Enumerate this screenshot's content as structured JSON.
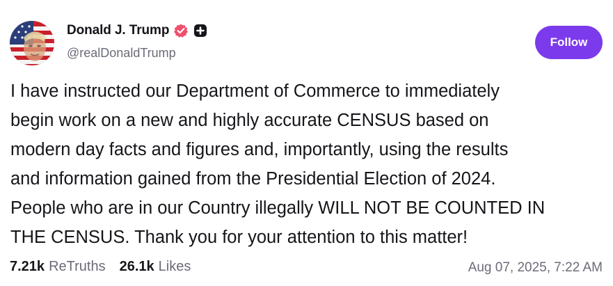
{
  "author": {
    "display_name": "Donald J. Trump",
    "handle": "@realDonaldTrump",
    "avatar_icon": "avatar-flag-portrait",
    "badges": [
      "verified-icon",
      "plus-icon"
    ]
  },
  "follow_label": "Follow",
  "post": {
    "lines": [
      "I have instructed our Department of Commerce to immediately",
      "begin work on a new and highly accurate CENSUS based on",
      "modern day facts and figures and, importantly, using the results",
      "and information gained from the Presidential Election of 2024.",
      "People who are in our Country illegally WILL NOT BE COUNTED IN",
      "THE CENSUS. Thank you for your attention to this matter!"
    ]
  },
  "stats": {
    "retruths_count": "7.21k",
    "retruths_label": "ReTruths",
    "likes_count": "26.1k",
    "likes_label": "Likes"
  },
  "timestamp": "Aug 07, 2025, 7:22 AM",
  "colors": {
    "accent": "#7c3aed",
    "verified": "#ef4f6b",
    "muted_text": "#6b6b78"
  }
}
